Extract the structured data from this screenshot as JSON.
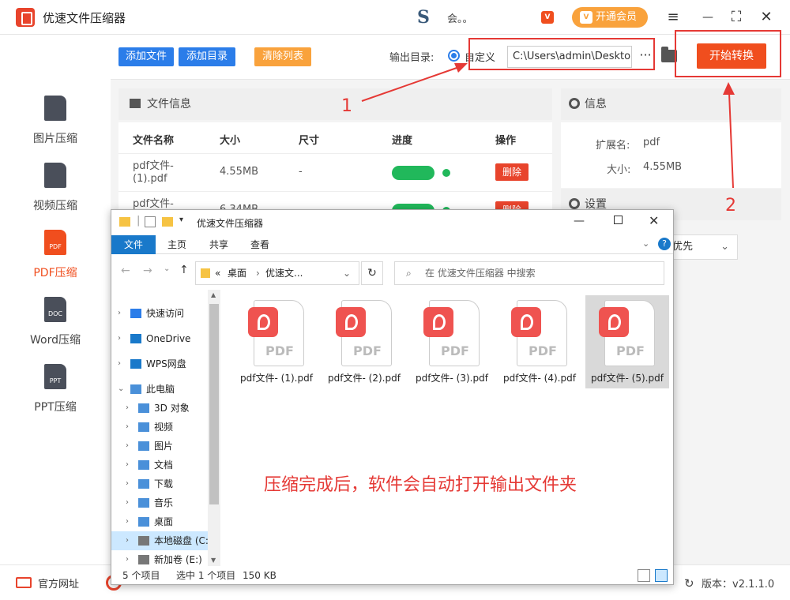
{
  "app": {
    "title": "优速文件压缩器",
    "username": "会。。",
    "vip_badge": "V",
    "vip_label": "开通会员"
  },
  "window_controls": {
    "menu": "≡",
    "minimize": "—",
    "maximize": "⛶",
    "close": "✕"
  },
  "sidebar": {
    "items": [
      {
        "label": "图片压缩",
        "icon": "image-file-icon",
        "active": false
      },
      {
        "label": "视频压缩",
        "icon": "video-file-icon",
        "active": false
      },
      {
        "label": "PDF压缩",
        "icon": "pdf-file-icon",
        "active": true,
        "icon_text": "PDF"
      },
      {
        "label": "Word压缩",
        "icon": "doc-file-icon",
        "active": false,
        "icon_text": "DOC"
      },
      {
        "label": "PPT压缩",
        "icon": "ppt-file-icon",
        "active": false,
        "icon_text": "PPT"
      }
    ]
  },
  "toolbar": {
    "add_file": "添加文件",
    "add_dir": "添加目录",
    "clear_list": "清除列表",
    "output_label": "输出目录:",
    "radio_label": "自定义",
    "output_path": "C:\\Users\\admin\\Deskto",
    "more": "···",
    "start": "开始转换"
  },
  "file_panel": {
    "title": "文件信息",
    "columns": [
      "文件名称",
      "大小",
      "尺寸",
      "进度",
      "操作"
    ],
    "rows": [
      {
        "name_1": "pdf文件-",
        "name_2": "(1).pdf",
        "size": "4.55MB",
        "dim": "-",
        "progress": 1.0,
        "action": "删除"
      },
      {
        "name_1": "pdf文件-",
        "size": "6.34MB",
        "progress": 1.0,
        "action": "删除"
      }
    ]
  },
  "info_panel": {
    "title": "信息",
    "ext_label": "扩展名:",
    "ext_value": "pdf",
    "size_label": "大小:",
    "size_value": "4.55MB"
  },
  "settings_panel": {
    "title": "设置",
    "select_value": "优先"
  },
  "annotations": {
    "num1": "1",
    "num2": "2",
    "caption": "压缩完成后，软件会自动打开输出文件夹"
  },
  "footer": {
    "website": "官方网址",
    "version": "版本：v2.1.1.0"
  },
  "explorer": {
    "title": "优速文件压缩器",
    "tabs": [
      "文件",
      "主页",
      "共享",
      "查看"
    ],
    "address": {
      "prefix": "«",
      "part1": "桌面",
      "sep": "›",
      "part2": "优速文..."
    },
    "search_placeholder": "在 优速文件压缩器 中搜索",
    "tree": [
      {
        "label": "快速访问",
        "icon": "star-icon",
        "arrow": "›",
        "indent": 0
      },
      {
        "label": "OneDrive",
        "icon": "cloud-icon",
        "arrow": "›",
        "indent": 0
      },
      {
        "label": "WPS网盘",
        "icon": "cloud-icon",
        "arrow": "›",
        "indent": 0
      },
      {
        "label": "此电脑",
        "icon": "computer-icon",
        "arrow": "⌄",
        "indent": 0
      },
      {
        "label": "3D 对象",
        "icon": "cube-icon",
        "arrow": "›",
        "indent": 1
      },
      {
        "label": "视频",
        "icon": "video-icon",
        "arrow": "›",
        "indent": 1
      },
      {
        "label": "图片",
        "icon": "picture-icon",
        "arrow": "›",
        "indent": 1
      },
      {
        "label": "文档",
        "icon": "document-icon",
        "arrow": "›",
        "indent": 1
      },
      {
        "label": "下载",
        "icon": "download-icon",
        "arrow": "›",
        "indent": 1
      },
      {
        "label": "音乐",
        "icon": "music-icon",
        "arrow": "›",
        "indent": 1
      },
      {
        "label": "桌面",
        "icon": "desktop-icon",
        "arrow": "›",
        "indent": 1
      },
      {
        "label": "本地磁盘 (C:",
        "icon": "drive-icon",
        "arrow": "›",
        "indent": 1,
        "selected": true
      },
      {
        "label": "新加卷 (E:)",
        "icon": "drive-icon",
        "arrow": "›",
        "indent": 1
      }
    ],
    "files": [
      {
        "label": "pdf文件- (1).pdf",
        "selected": false
      },
      {
        "label": "pdf文件- (2).pdf",
        "selected": false
      },
      {
        "label": "pdf文件- (3).pdf",
        "selected": false
      },
      {
        "label": "pdf文件- (4).pdf",
        "selected": false
      },
      {
        "label": "pdf文件- (5).pdf",
        "selected": true
      }
    ],
    "file_badge_text": "PDF",
    "status": {
      "count": "5 个项目",
      "selected": "选中 1 个项目",
      "size": "150 KB"
    }
  },
  "colors": {
    "accent": "#f04e1e",
    "blue": "#2b7de9",
    "green": "#21b85b",
    "annotation": "#e53935",
    "vip": "#f9a23c"
  }
}
